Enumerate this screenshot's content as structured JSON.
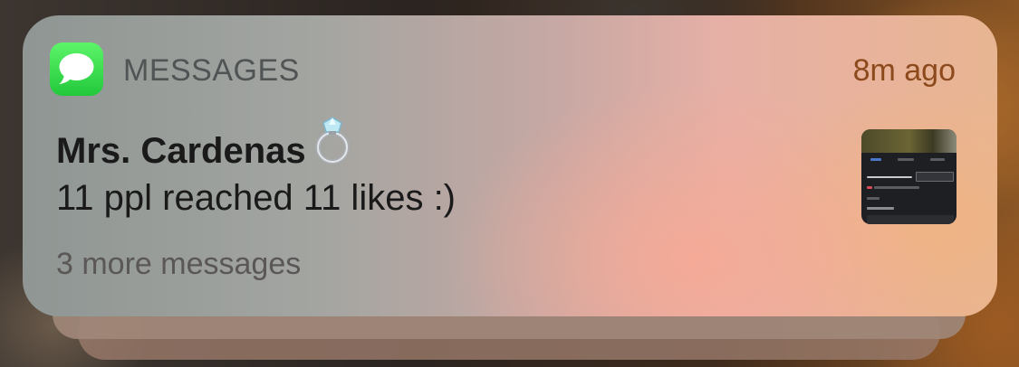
{
  "notification": {
    "app_name": "MESSAGES",
    "time": "8m ago",
    "sender": "Mrs. Cardenas",
    "sender_emoji_icon": "ring-icon",
    "message": "11 ppl reached 11 likes :)",
    "more_text": "3 more messages",
    "app_icon": "messages-app-icon",
    "attachment_icon": "image-thumbnail"
  },
  "colors": {
    "app_icon_green": "#34d34a",
    "time_text": "#8c4a1c",
    "primary_text": "#1a1a1a",
    "secondary_text": "#5a5756"
  }
}
